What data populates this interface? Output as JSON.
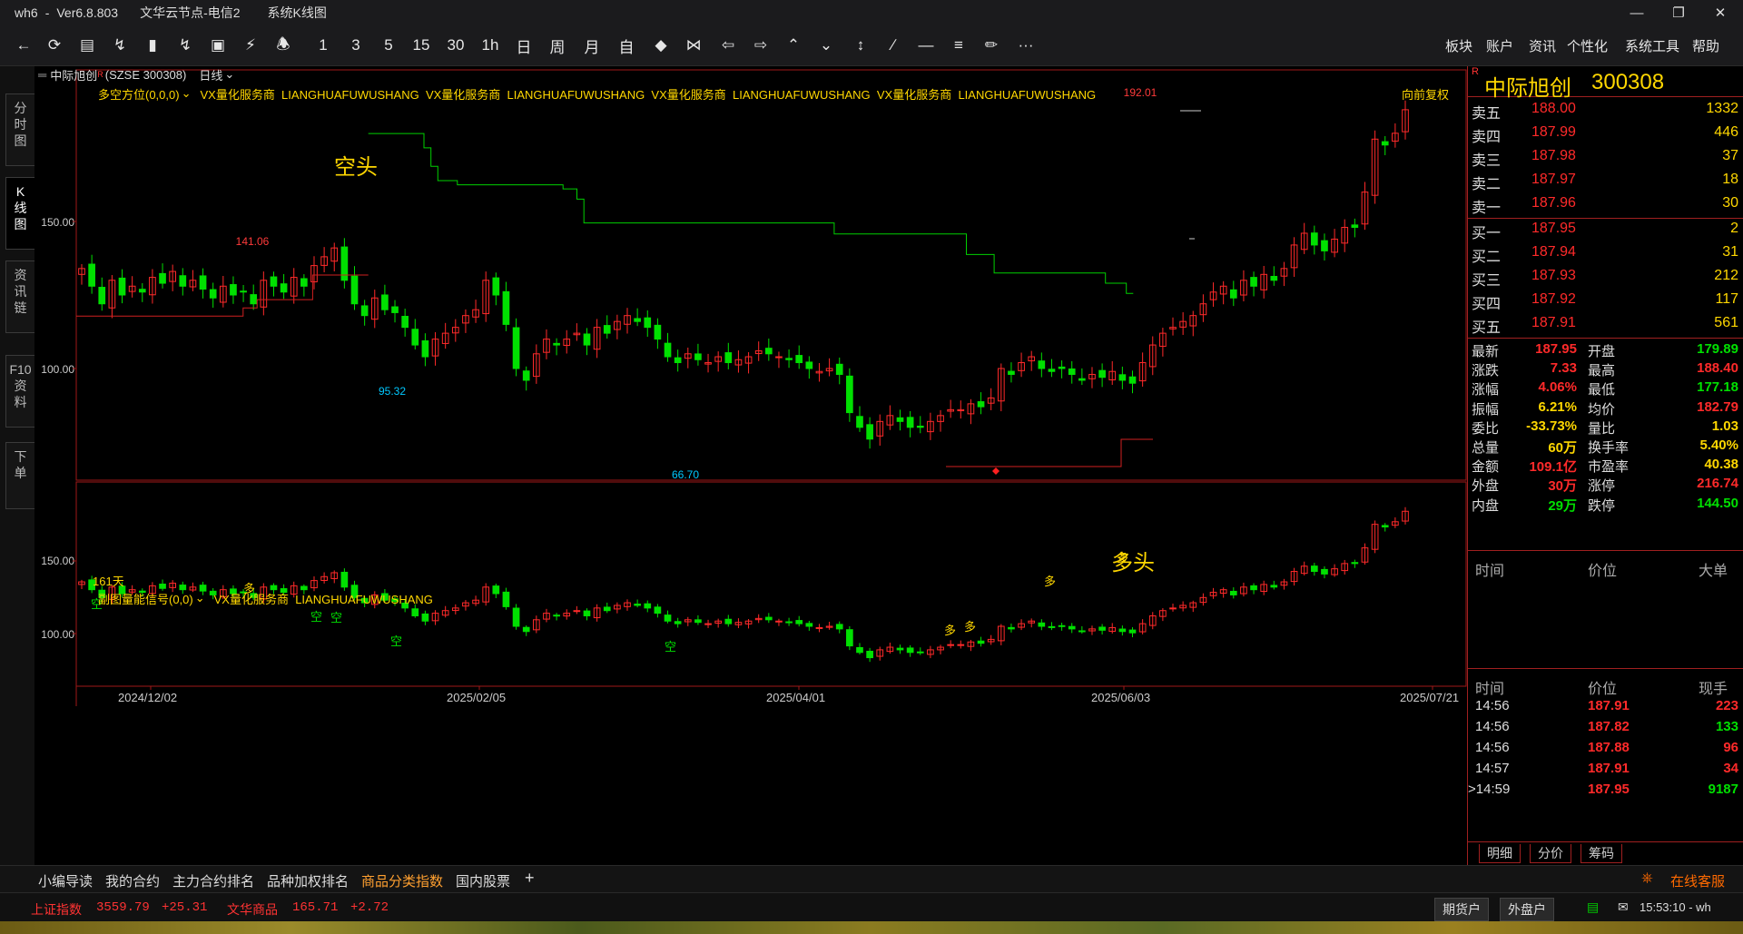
{
  "window": {
    "app": "wh6",
    "version": "Ver6.8.803",
    "server": "文华云节点-电信2",
    "view": "系统K线图",
    "minimize": "—",
    "restore": "❐",
    "close": "✕"
  },
  "toolbar": {
    "periods": [
      "1",
      "3",
      "5",
      "15",
      "30",
      "1h",
      "日",
      "周",
      "月",
      "自"
    ],
    "menus": [
      "板块",
      "账户",
      "资讯",
      "个性化",
      "系统工具",
      "帮助"
    ],
    "more": "···"
  },
  "left_tabs": [
    {
      "label": "分\n时\n图"
    },
    {
      "label": "K\n线\n图"
    },
    {
      "label": "资\n讯\n链"
    },
    {
      "label": "F10\n资\n料"
    },
    {
      "label": "下\n单"
    }
  ],
  "chart_header": {
    "symbol_name": "中际旭创",
    "symbol_code": "(SZSE 300308)",
    "period": "日线"
  },
  "main_panel": {
    "indicator": "多空方位(0,0,0)",
    "vendor_text": "VX量化服务商  LIANGHUAFUWUSHANG  VX量化服务商  LIANGHUAFUWUSHANG  VX量化服务商  LIANGHUAFUWUSHANG  VX量化服务商  LIANGHUAFUWUSHANG",
    "adjust": "向前复权",
    "days": "161天",
    "label_short": "空头",
    "label_long": "多头"
  },
  "sub_panel": {
    "indicator": "副图量能信号(0,0)",
    "vendor_text": "VX量化服务商  LIANGHUAFUWUSHANG"
  },
  "chart_data": {
    "type": "candlestick",
    "y_ticks": [
      "150.00",
      "100.00"
    ],
    "sub_y_ticks": [
      "150.00",
      "100.00"
    ],
    "x_ticks": [
      "2024/12/02",
      "2025/02/05",
      "2025/04/01",
      "2025/06/03",
      "2025/07/21"
    ],
    "annotations": [
      "141.06",
      "95.32",
      "66.70",
      "192.01"
    ],
    "marks_short": [
      "空",
      "空",
      "空",
      "空",
      "空"
    ],
    "marks_long": [
      "多",
      "多",
      "多",
      "多",
      "多"
    ],
    "price_path": [
      134,
      128,
      122,
      130,
      125,
      128,
      126,
      131,
      129,
      133,
      128,
      130,
      127,
      124,
      128,
      125,
      126,
      122,
      130,
      128,
      126,
      131,
      128,
      135,
      138,
      141,
      130,
      122,
      118,
      124,
      120,
      119,
      114,
      108,
      104,
      110,
      112,
      114,
      118,
      120,
      130,
      125,
      115,
      100,
      96,
      105,
      110,
      108,
      110,
      112,
      108,
      114,
      112,
      116,
      118,
      116,
      114,
      110,
      104,
      102,
      105,
      103,
      102,
      104,
      102,
      103,
      104,
      106,
      105,
      104,
      103,
      102,
      100,
      99,
      100,
      98,
      85,
      80,
      76,
      82,
      84,
      82,
      80,
      80,
      82,
      84,
      86,
      86,
      88,
      87,
      90,
      100,
      98,
      102,
      104,
      100,
      99,
      100,
      98,
      96,
      98,
      97,
      99,
      96,
      95,
      102,
      108,
      112,
      114,
      116,
      118,
      122,
      126,
      128,
      124,
      130,
      128,
      132,
      130,
      134,
      142,
      146,
      142,
      140,
      144,
      148,
      148,
      160,
      178,
      176,
      180,
      188
    ],
    "bull_bear_short_line": [
      [
        0.21,
        0.155
      ],
      [
        0.25,
        0.155
      ],
      [
        0.25,
        0.19
      ],
      [
        0.255,
        0.19
      ],
      [
        0.255,
        0.235
      ],
      [
        0.26,
        0.235
      ],
      [
        0.26,
        0.27
      ],
      [
        0.274,
        0.27
      ],
      [
        0.274,
        0.28
      ],
      [
        0.35,
        0.28
      ],
      [
        0.35,
        0.29
      ],
      [
        0.36,
        0.29
      ],
      [
        0.36,
        0.315
      ],
      [
        0.365,
        0.315
      ],
      [
        0.365,
        0.373
      ],
      [
        0.545,
        0.373
      ],
      [
        0.545,
        0.4
      ],
      [
        0.64,
        0.4
      ],
      [
        0.64,
        0.45
      ],
      [
        0.66,
        0.45
      ],
      [
        0.66,
        0.495
      ],
      [
        0.74,
        0.495
      ],
      [
        0.74,
        0.52
      ],
      [
        0.755,
        0.52
      ],
      [
        0.755,
        0.545
      ],
      [
        0.76,
        0.545
      ]
    ],
    "bull_bear_long_line": [
      [
        0.0,
        0.6
      ],
      [
        0.12,
        0.6
      ],
      [
        0.12,
        0.58
      ],
      [
        0.13,
        0.58
      ],
      [
        0.13,
        0.56
      ],
      [
        0.17,
        0.56
      ],
      [
        0.17,
        0.5
      ],
      [
        0.21,
        0.5
      ]
    ]
  },
  "quote": {
    "name": "中际旭创",
    "code": "300308",
    "asks": [
      {
        "label": "卖五",
        "price": "188.00",
        "vol": "1332"
      },
      {
        "label": "卖四",
        "price": "187.99",
        "vol": "446"
      },
      {
        "label": "卖三",
        "price": "187.98",
        "vol": "37"
      },
      {
        "label": "卖二",
        "price": "187.97",
        "vol": "18"
      },
      {
        "label": "卖一",
        "price": "187.96",
        "vol": "30"
      }
    ],
    "bids": [
      {
        "label": "买一",
        "price": "187.95",
        "vol": "2"
      },
      {
        "label": "买二",
        "price": "187.94",
        "vol": "31"
      },
      {
        "label": "买三",
        "price": "187.93",
        "vol": "212"
      },
      {
        "label": "买四",
        "price": "187.92",
        "vol": "117"
      },
      {
        "label": "买五",
        "price": "187.91",
        "vol": "561"
      }
    ],
    "stats": [
      {
        "l1": "最新",
        "v1": "187.95",
        "c1": "red",
        "l2": "开盘",
        "v2": "179.89",
        "c2": "green"
      },
      {
        "l1": "涨跌",
        "v1": "7.33",
        "c1": "red",
        "l2": "最高",
        "v2": "188.40",
        "c2": "red"
      },
      {
        "l1": "涨幅",
        "v1": "4.06%",
        "c1": "red",
        "l2": "最低",
        "v2": "177.18",
        "c2": "green"
      },
      {
        "l1": "振幅",
        "v1": "6.21%",
        "c1": "yellow",
        "l2": "均价",
        "v2": "182.79",
        "c2": "red"
      },
      {
        "l1": "委比",
        "v1": "-33.73%",
        "c1": "yellow",
        "l2": "量比",
        "v2": "1.03",
        "c2": "yellow"
      },
      {
        "l1": "总量",
        "v1": "60万",
        "c1": "yellow",
        "l2": "换手率",
        "v2": "5.40%",
        "c2": "yellow"
      },
      {
        "l1": "金额",
        "v1": "109.1亿",
        "c1": "red",
        "l2": "市盈率",
        "v2": "40.38",
        "c2": "yellow"
      },
      {
        "l1": "外盘",
        "v1": "30万",
        "c1": "red",
        "l2": "涨停",
        "v2": "216.74",
        "c2": "red"
      },
      {
        "l1": "内盘",
        "v1": "29万",
        "c1": "green",
        "l2": "跌停",
        "v2": "144.50",
        "c2": "green"
      }
    ],
    "big_header": [
      "时间",
      "价位",
      "大单"
    ],
    "ticks_header": [
      "时间",
      "价位",
      "现手"
    ],
    "ticks": [
      {
        "time": "14:56",
        "price": "187.91",
        "vol": "223",
        "color": "red"
      },
      {
        "time": "14:56",
        "price": "187.82",
        "vol": "133",
        "color": "green"
      },
      {
        "time": "14:56",
        "price": "187.88",
        "vol": "96",
        "color": "red"
      },
      {
        "time": "14:57",
        "price": "187.91",
        "vol": "34",
        "color": "red"
      },
      {
        "time": "14:59",
        "price": "187.95",
        "vol": "9187",
        "color": "green"
      }
    ],
    "bottom_tabs": [
      "明细",
      "分价",
      "筹码"
    ]
  },
  "bottom_tabs": [
    "小编导读",
    "我的合约",
    "主力合约排名",
    "品种加权排名",
    "商品分类指数",
    "国内股票"
  ],
  "bottom_add": "+",
  "online_service": "在线客服",
  "status": {
    "idx1_name": "上证指数",
    "idx1_val": "3559.79",
    "idx1_chg": "+25.31",
    "idx2_name": "文华商品",
    "idx2_val": "165.71",
    "idx2_chg": "+2.72",
    "btn_futures": "期货户",
    "btn_foreign": "外盘户",
    "clock": "15:53:10 - wh"
  },
  "colors": {
    "up": "#ff2a2a",
    "down": "#00e000",
    "axis": "#a01818",
    "text_yellow": "#ffd700",
    "cyan": "#00c8ff"
  }
}
